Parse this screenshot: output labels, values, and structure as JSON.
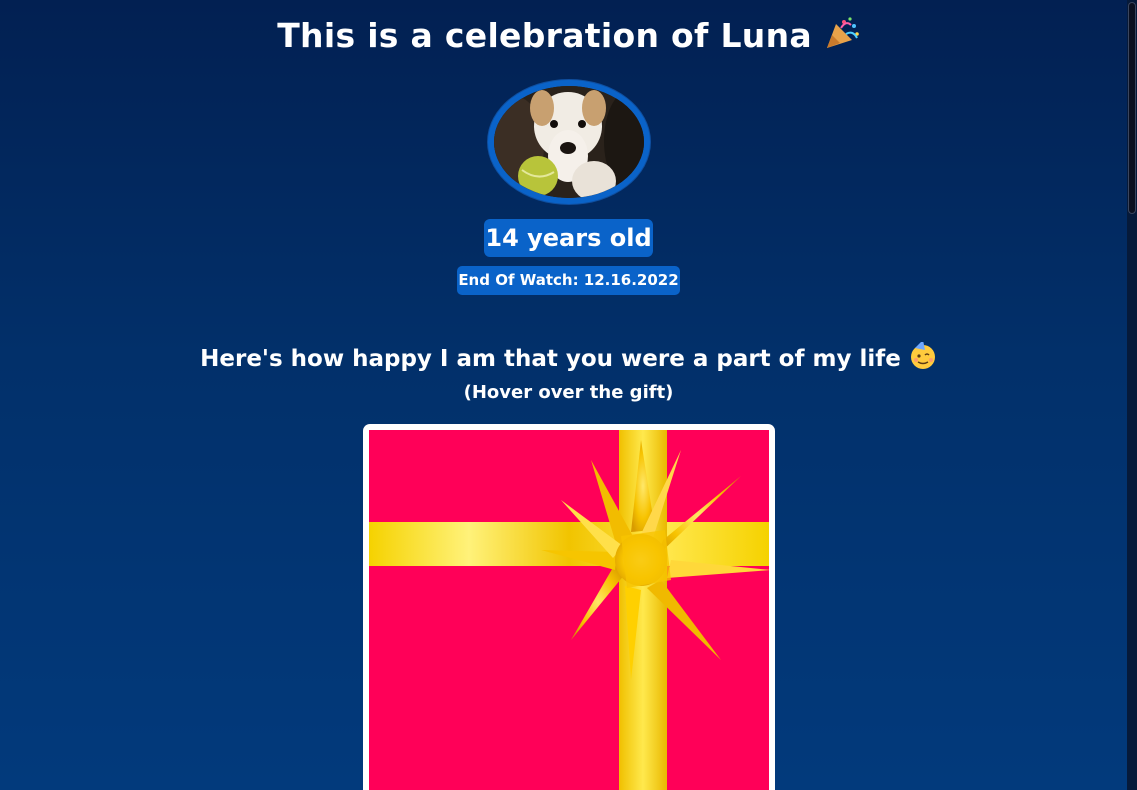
{
  "header": {
    "title": "This is a celebration of Luna",
    "title_emoji": "🎉",
    "title_emoji_icon": "party-popper-icon"
  },
  "profile": {
    "age": "14 years old",
    "end_of_watch": "End Of Watch: 12.16.2022"
  },
  "message": {
    "text": "Here's how happy I am that you were a part of my life",
    "emoji": "🥳",
    "emoji_icon": "partying-face-icon",
    "hint": "(Hover over the gift)"
  },
  "colors": {
    "background_top": "#022052",
    "background_bottom": "#023a7c",
    "badge": "#0a63c9",
    "gift_box": "#ff0058",
    "ribbon": "#ffd200"
  }
}
